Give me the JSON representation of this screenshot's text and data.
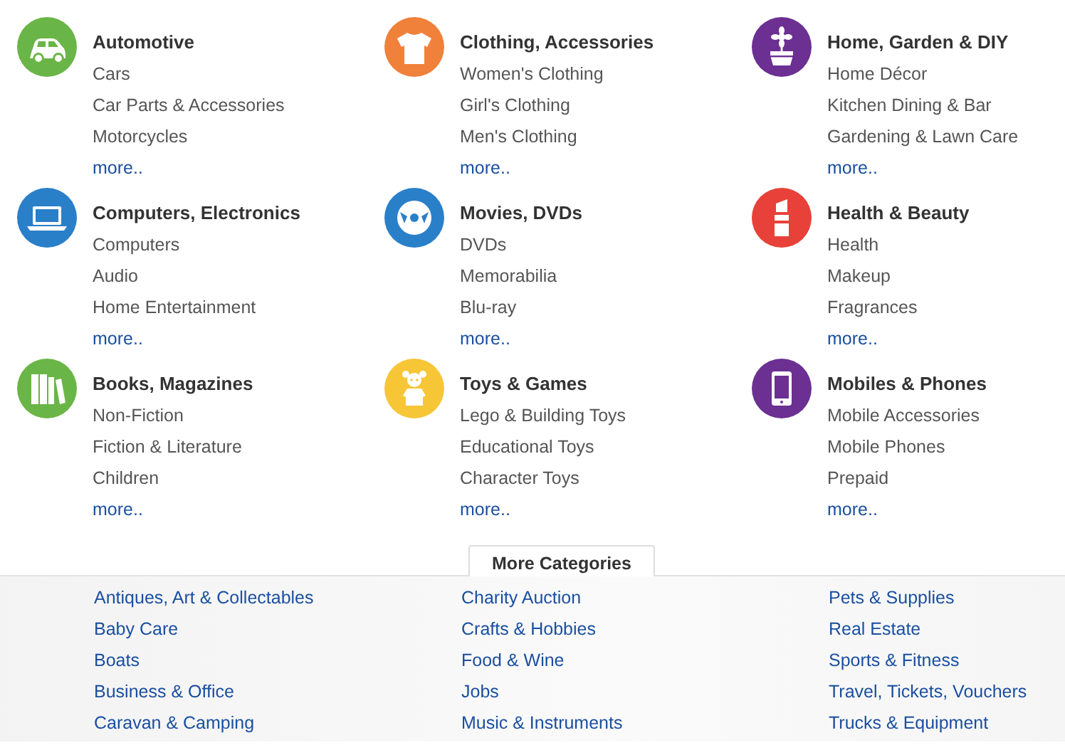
{
  "categories": [
    {
      "kind": "car",
      "color": "#6ab547",
      "title": "Automotive",
      "items": [
        "Cars",
        "Car Parts & Accessories",
        "Motorcycles"
      ],
      "more": "more.."
    },
    {
      "kind": "shirt",
      "color": "#f0813a",
      "title": "Clothing, Accessories",
      "items": [
        "Women's Clothing",
        "Girl's Clothing",
        "Men's Clothing"
      ],
      "more": "more.."
    },
    {
      "kind": "flower",
      "color": "#6b3092",
      "title": "Home, Garden & DIY",
      "items": [
        "Home Décor",
        "Kitchen Dining & Bar",
        "Gardening & Lawn Care"
      ],
      "more": "more.."
    },
    {
      "kind": "laptop",
      "color": "#2a7fc9",
      "title": "Computers, Electronics",
      "items": [
        "Computers",
        "Audio",
        "Home Entertainment"
      ],
      "more": "more.."
    },
    {
      "kind": "disc",
      "color": "#2a7fc9",
      "title": "Movies, DVDs",
      "items": [
        "DVDs",
        "Memorabilia",
        "Blu-ray"
      ],
      "more": "more.."
    },
    {
      "kind": "lipstick",
      "color": "#e8413a",
      "title": "Health & Beauty",
      "items": [
        "Health",
        "Makeup",
        "Fragrances"
      ],
      "more": "more.."
    },
    {
      "kind": "books",
      "color": "#6ab547",
      "title": "Books, Magazines",
      "items": [
        "Non-Fiction",
        "Fiction & Literature",
        "Children"
      ],
      "more": "more.."
    },
    {
      "kind": "doll",
      "color": "#f6c636",
      "title": "Toys & Games",
      "items": [
        "Lego & Building Toys",
        "Educational Toys",
        "Character Toys"
      ],
      "more": "more.."
    },
    {
      "kind": "phone",
      "color": "#6b3092",
      "title": "Mobiles & Phones",
      "items": [
        "Mobile Accessories",
        "Mobile Phones",
        "Prepaid"
      ],
      "more": "more.."
    }
  ],
  "more_categories": {
    "tab": "More Categories",
    "columns": [
      [
        "Antiques, Art & Collectables",
        "Baby Care",
        "Boats",
        "Business & Office",
        "Caravan & Camping"
      ],
      [
        "Charity Auction",
        "Crafts & Hobbies",
        "Food & Wine",
        "Jobs",
        "Music & Instruments"
      ],
      [
        "Pets & Supplies",
        "Real Estate",
        "Sports & Fitness",
        "Travel, Tickets, Vouchers",
        "Trucks & Equipment"
      ]
    ]
  }
}
